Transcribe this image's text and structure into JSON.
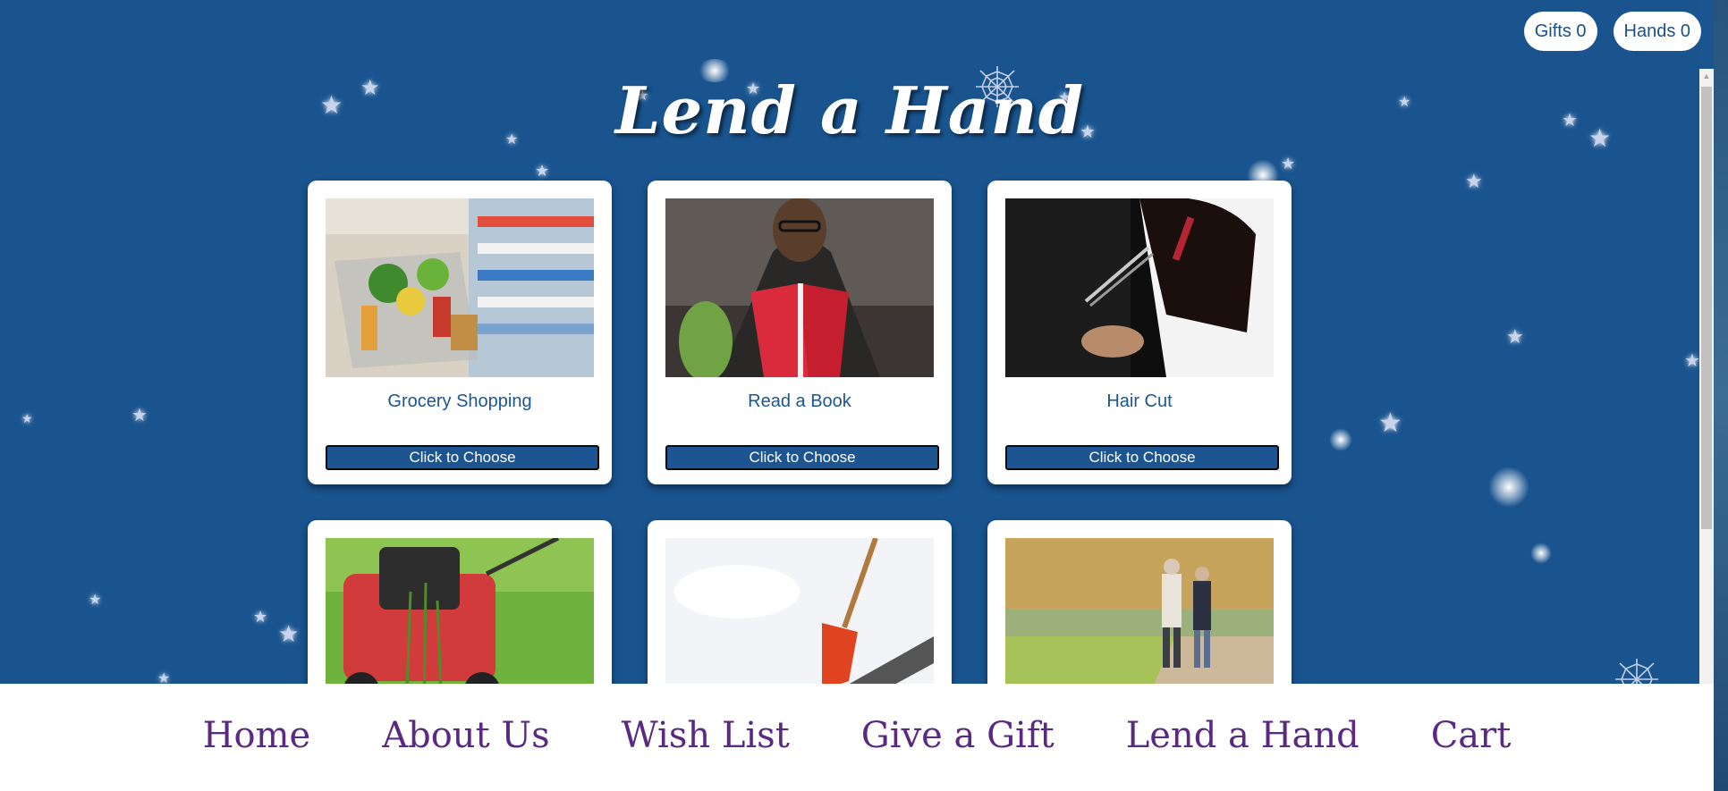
{
  "header": {
    "gifts_label": "Gifts 0",
    "hands_label": "Hands 0"
  },
  "page": {
    "title": "Lend a Hand"
  },
  "cards": [
    {
      "title": "Grocery Shopping",
      "button": "Click to Choose",
      "image": "grocery-cart-photo"
    },
    {
      "title": "Read a Book",
      "button": "Click to Choose",
      "image": "man-reading-book-photo"
    },
    {
      "title": "Hair Cut",
      "button": "Click to Choose",
      "image": "haircut-photo"
    },
    {
      "title": "",
      "button": "",
      "image": "lawn-mower-photo"
    },
    {
      "title": "",
      "button": "",
      "image": "snow-shovel-photo"
    },
    {
      "title": "",
      "button": "",
      "image": "couple-walking-photo"
    }
  ],
  "footer_nav": [
    {
      "label": "Home"
    },
    {
      "label": "About Us"
    },
    {
      "label": "Wish List"
    },
    {
      "label": "Give a Gift"
    },
    {
      "label": "Lend a Hand"
    },
    {
      "label": "Cart"
    }
  ],
  "colors": {
    "background": "#19548f",
    "accent": "#1c5591",
    "nav_text": "#5a2a82",
    "card": "#ffffff"
  }
}
